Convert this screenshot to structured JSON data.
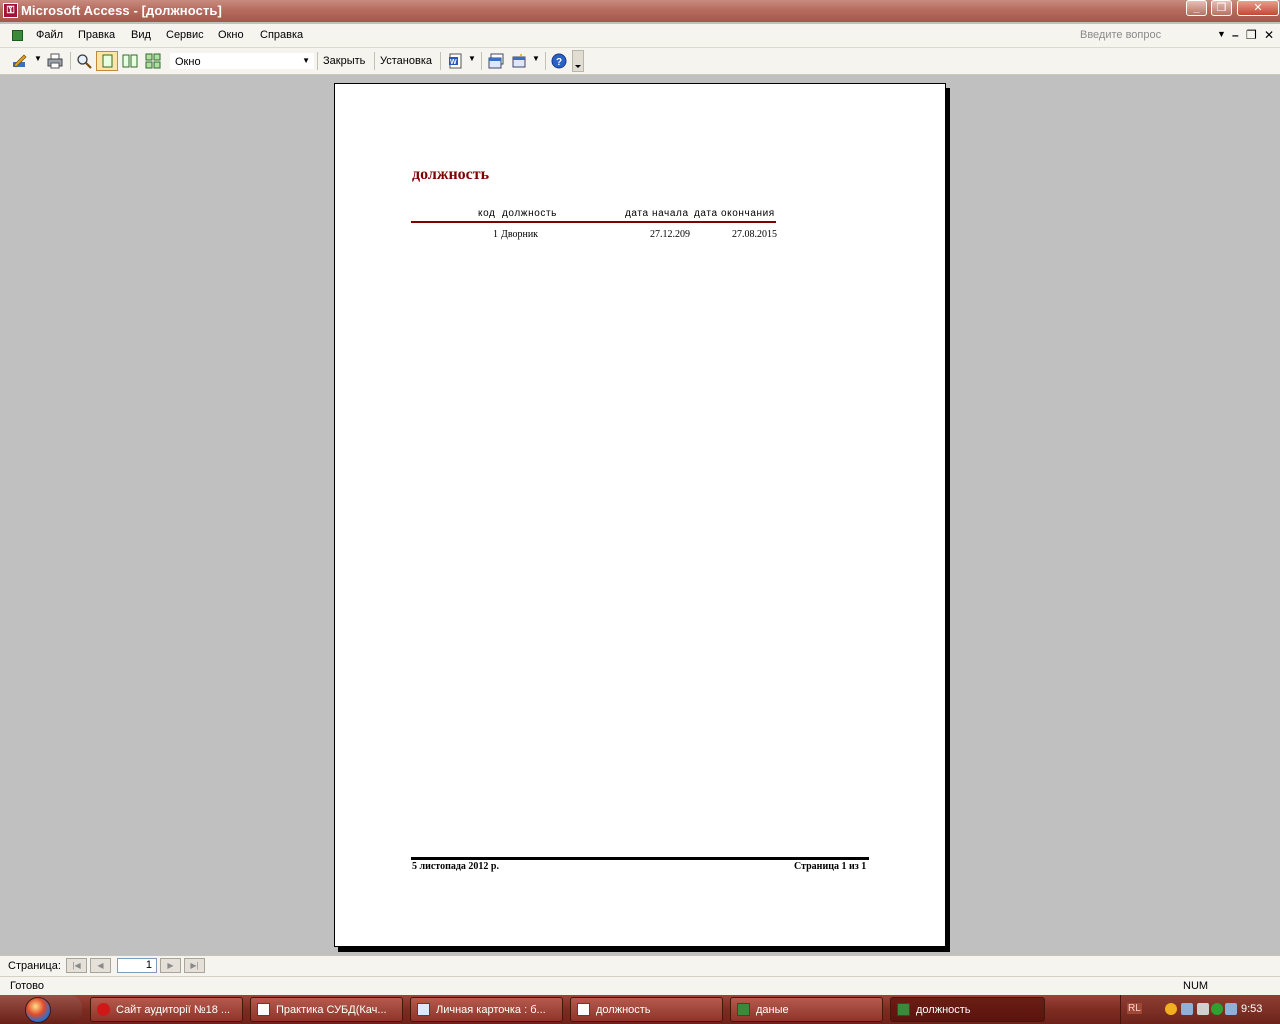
{
  "window": {
    "title": "Microsoft Access - [должность]",
    "icon": "access-key-icon"
  },
  "window_controls": {
    "minimize": "_",
    "restore": "❐",
    "close": "✕"
  },
  "menu": {
    "items": [
      "Файл",
      "Правка",
      "Вид",
      "Сервис",
      "Окно",
      "Справка"
    ],
    "help_placeholder": "Введите вопрос",
    "mdi": {
      "minimize": "–",
      "restore": "❐",
      "close": "✕"
    }
  },
  "toolbar": {
    "zoom_value": "Окно",
    "close_label": "Закрыть",
    "setup_label": "Установка"
  },
  "report": {
    "title": "должность",
    "headers": {
      "code": "код",
      "position": "должность",
      "start": "дата начала",
      "end": "дата окончания"
    },
    "rows": [
      {
        "code": "1",
        "position": "Дворник",
        "start": "27.12.209",
        "end": "27.08.2015"
      }
    ],
    "footer": {
      "date": "5 листопада 2012 р.",
      "page": "Страница 1 из 1"
    }
  },
  "nav": {
    "label": "Страница:",
    "page": "1"
  },
  "status": {
    "text": "Готово",
    "num": "NUM"
  },
  "taskbar": {
    "tasks": [
      {
        "label": "Сайт аудиторії №18 ...",
        "icon": "opera-icon"
      },
      {
        "label": "Практика СУБД(Кач...",
        "icon": "word-icon"
      },
      {
        "label": "Личная карточка : б...",
        "icon": "form-icon"
      },
      {
        "label": "должность",
        "icon": "table-icon"
      },
      {
        "label": "даные",
        "icon": "access-icon"
      },
      {
        "label": "должность",
        "icon": "access-icon"
      }
    ],
    "lang": "RL",
    "clock": "9:53"
  },
  "colors": {
    "title_accent": "#800000",
    "taskbar": "#7e2c22"
  }
}
